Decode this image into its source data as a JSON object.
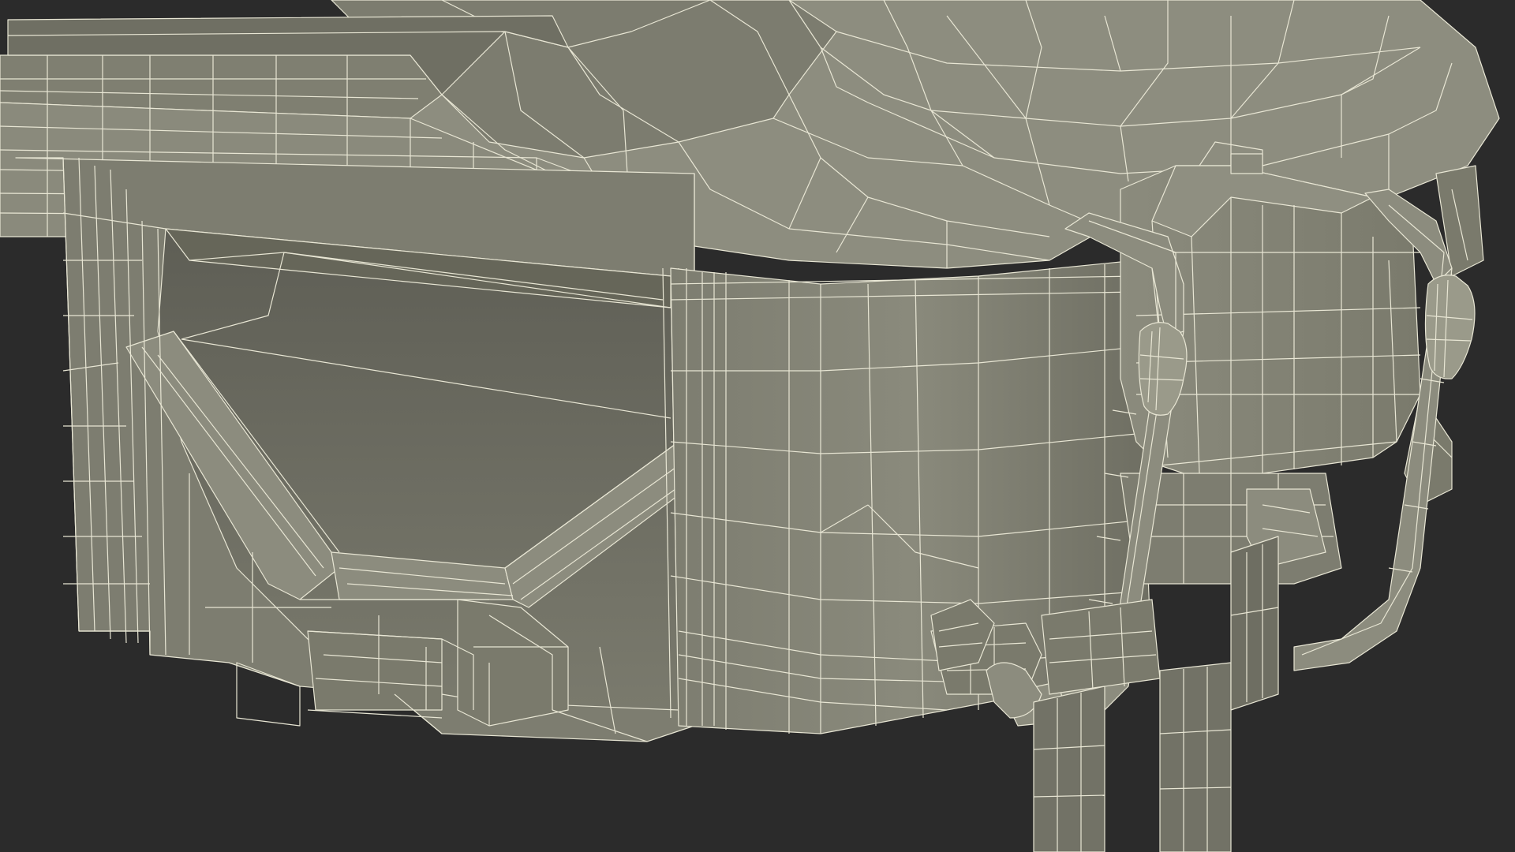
{
  "scene": {
    "subject": "3d-wireframe-model",
    "colors": {
      "background": "#2b2b2b",
      "surface": "#858576",
      "surface_light": "#9a9a8a",
      "surface_dark": "#5f5f52",
      "inner_panel": "#6b6b60",
      "wire": "#e8e6d4"
    }
  }
}
